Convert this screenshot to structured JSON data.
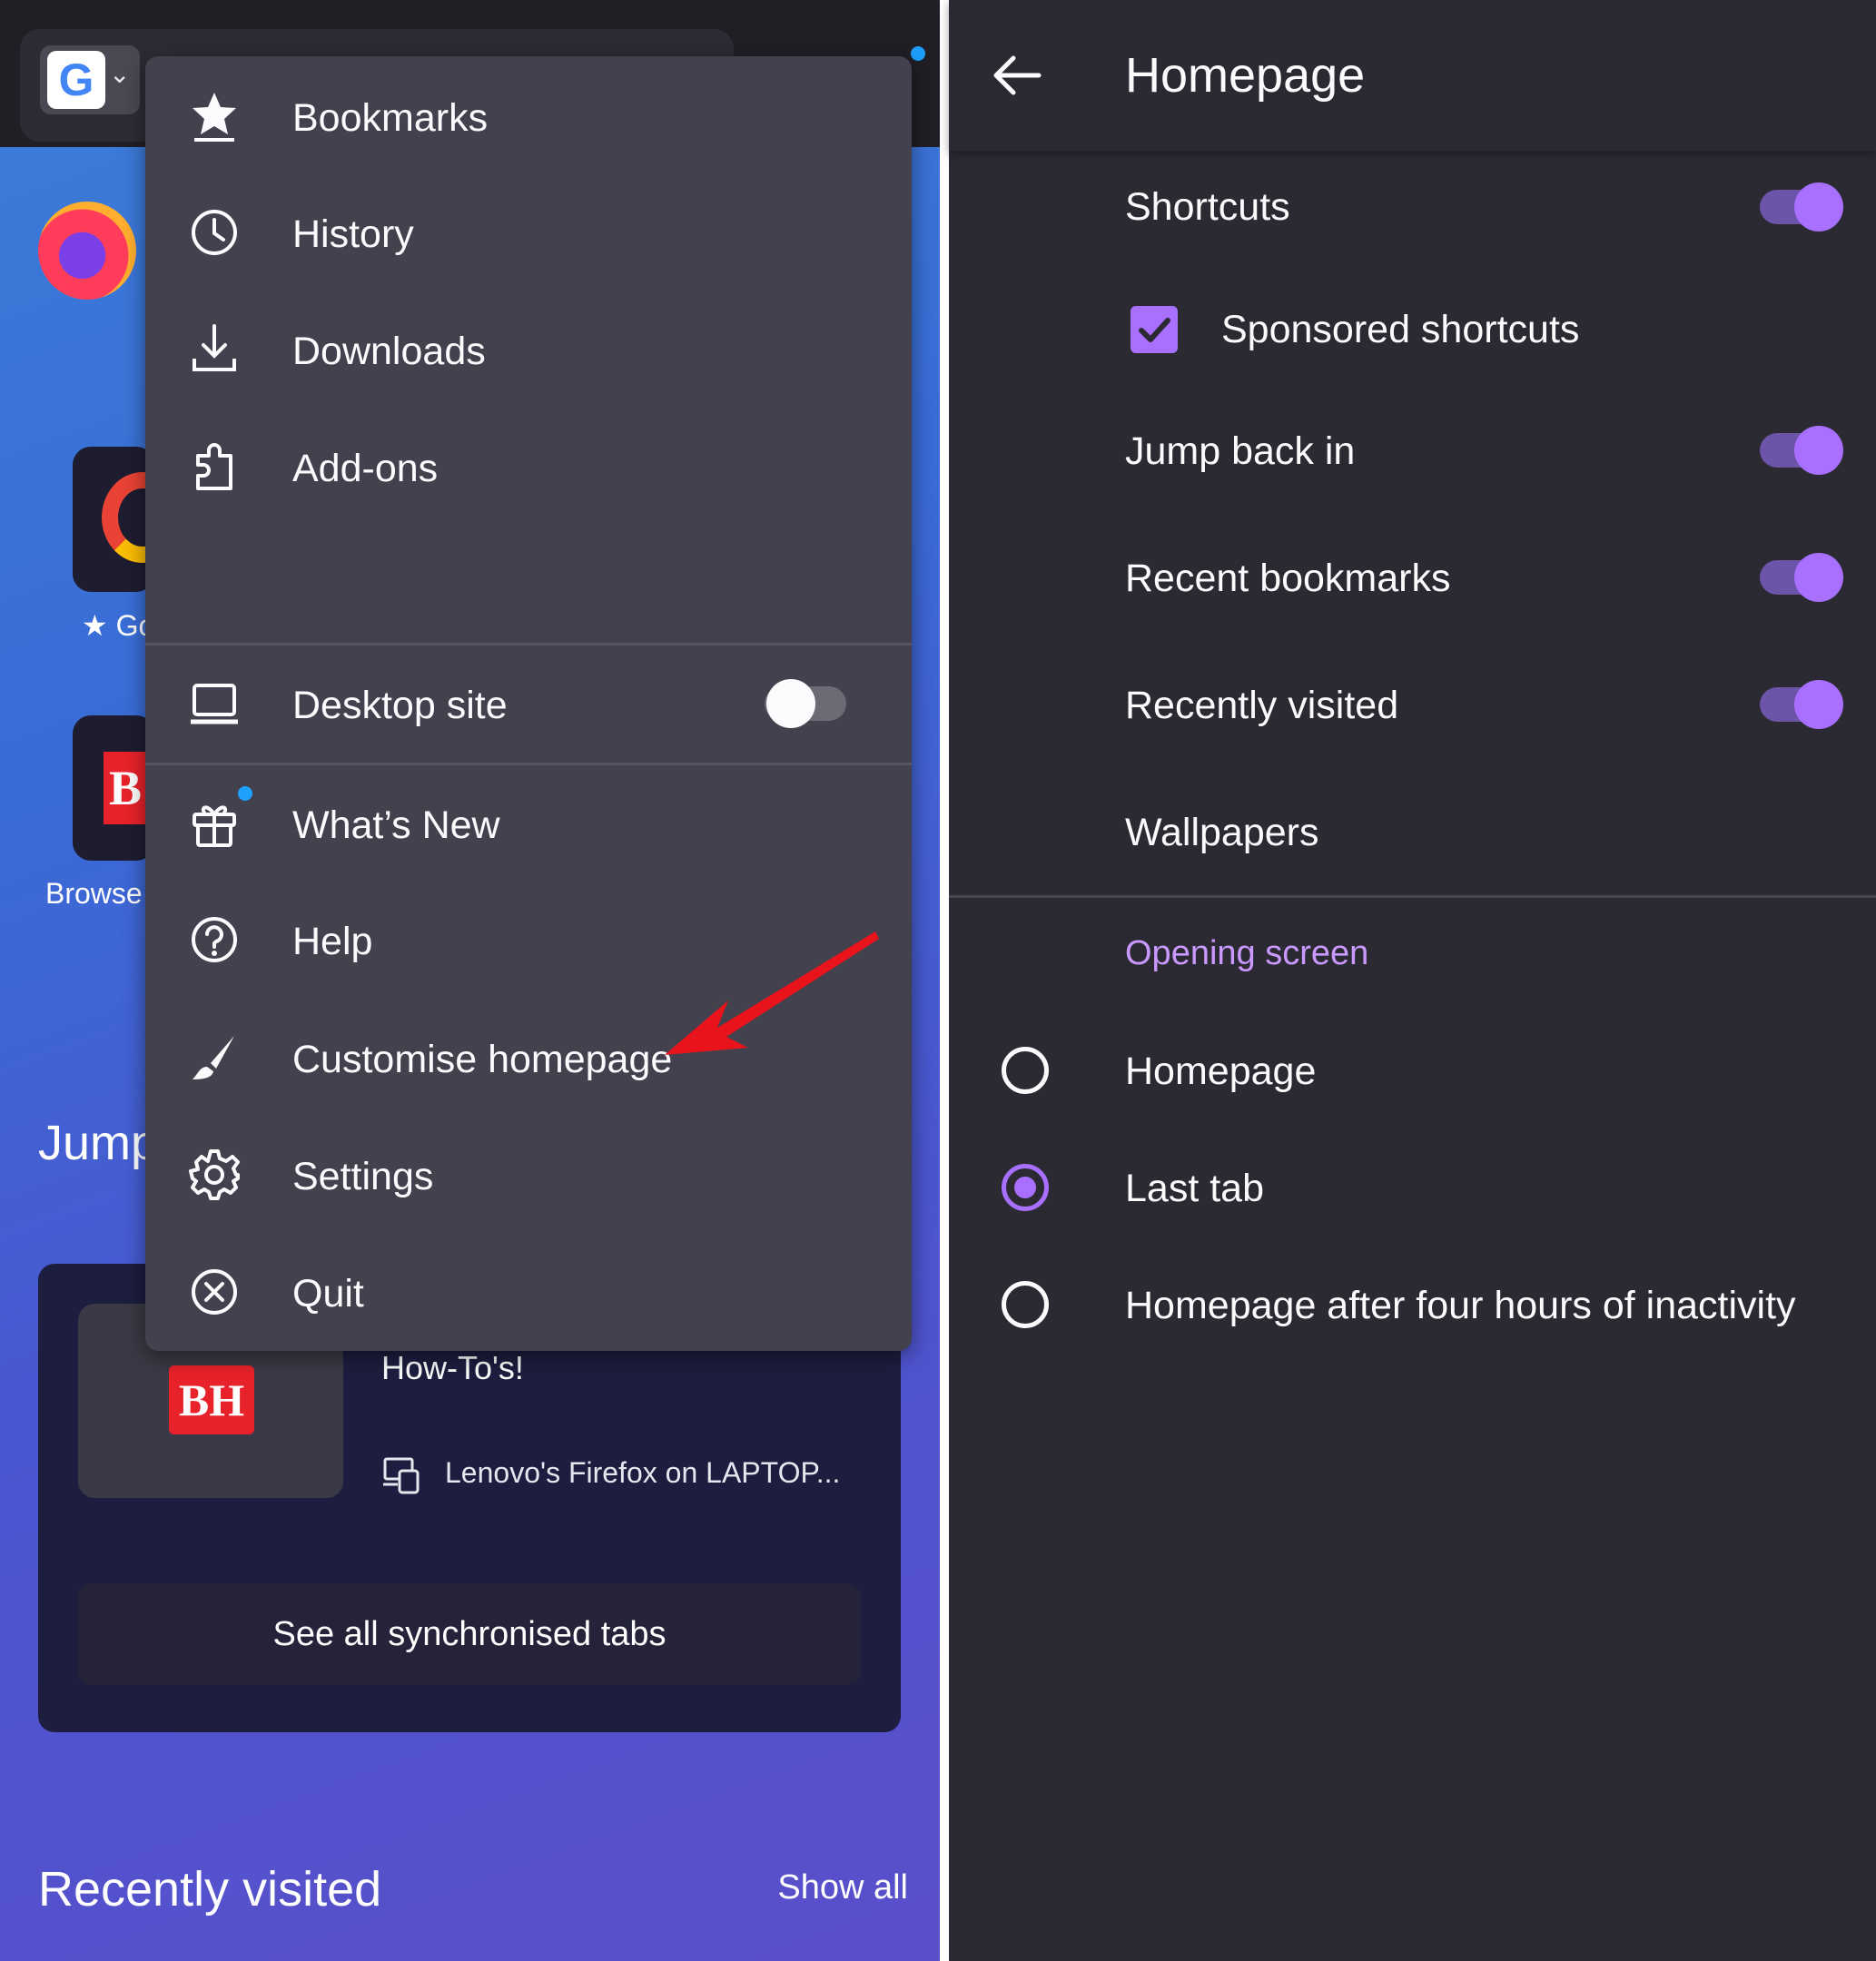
{
  "browser": {
    "search_engine_letter": "G",
    "tile1_label": "★ Go",
    "tile2_logo": "B",
    "tile2_label": "Browse",
    "jump_back_title": "Jump",
    "synced": {
      "logo": "BH",
      "title": "How-To's!",
      "device": "Lenovo's Firefox on LAPTOP...",
      "see_all": "See all synchronised tabs"
    },
    "recently_visited": "Recently visited",
    "show_all": "Show all"
  },
  "menu": {
    "items": [
      {
        "label": "Bookmarks",
        "icon": "star-icon"
      },
      {
        "label": "History",
        "icon": "clock-icon"
      },
      {
        "label": "Downloads",
        "icon": "download-icon"
      },
      {
        "label": "Add-ons",
        "icon": "puzzle-icon"
      },
      {
        "label": "Desktop site",
        "icon": "laptop-icon",
        "toggle": false
      },
      {
        "label": "What’s New",
        "icon": "gift-icon"
      },
      {
        "label": "Help",
        "icon": "help-icon"
      },
      {
        "label": "Customise homepage",
        "icon": "brush-icon"
      },
      {
        "label": "Settings",
        "icon": "gear-icon"
      },
      {
        "label": "Quit",
        "icon": "close-circle-icon"
      }
    ]
  },
  "settings": {
    "title": "Homepage",
    "toggles": [
      {
        "label": "Shortcuts",
        "on": true
      },
      {
        "label": "Sponsored shortcuts",
        "checked": true
      },
      {
        "label": "Jump back in",
        "on": true
      },
      {
        "label": "Recent bookmarks",
        "on": true
      },
      {
        "label": "Recently visited",
        "on": true
      },
      {
        "label": "Wallpapers"
      }
    ],
    "opening_screen": {
      "heading": "Opening screen",
      "options": [
        {
          "label": "Homepage",
          "selected": false
        },
        {
          "label": "Last tab",
          "selected": true
        },
        {
          "label": "Homepage after four hours of inactivity",
          "selected": false
        }
      ]
    }
  },
  "colors": {
    "accent": "#a970ff",
    "menu_bg": "#42414d",
    "settings_bg": "#2b2a33",
    "annotation_arrow": "#e8131b"
  }
}
